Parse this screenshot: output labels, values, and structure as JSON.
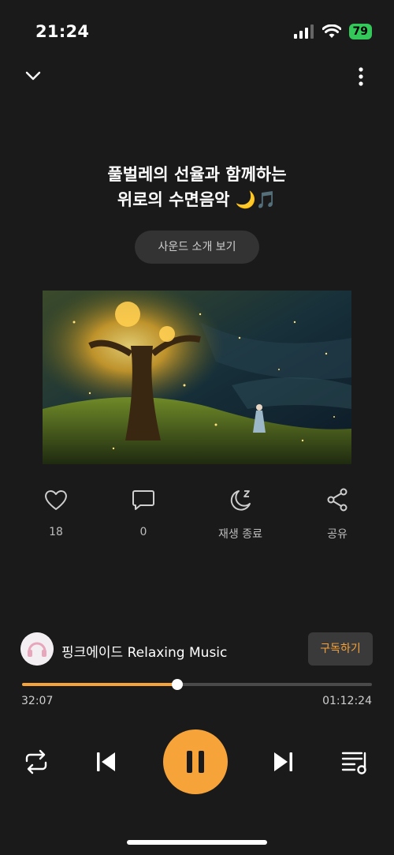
{
  "status": {
    "time": "21:24",
    "battery": "79"
  },
  "header": {
    "title_line1": "풀벌레의 선율과 함께하는",
    "title_line2": "위로의 수면음악 🌙🎵",
    "sound_intro_label": "사운드 소개 보기"
  },
  "actions": {
    "like_count": "18",
    "comment_count": "0",
    "sleep_timer_label": "재생 종료",
    "share_label": "공유"
  },
  "channel": {
    "name": "핑크에이드 Relaxing Music",
    "subscribe_label": "구독하기"
  },
  "player": {
    "current_time": "32:07",
    "duration": "01:12:24",
    "progress": 0.443
  },
  "colors": {
    "accent": "#f6a33a",
    "background": "#1a1a1a"
  }
}
